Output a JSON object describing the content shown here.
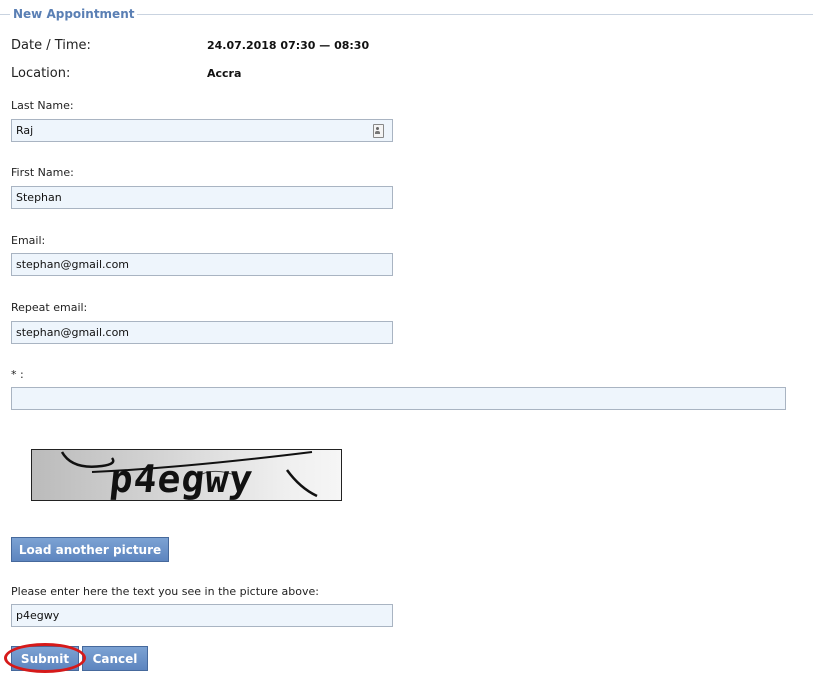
{
  "form": {
    "legend": "New Appointment",
    "date_time_label": "Date / Time:",
    "date_time_value": "24.07.2018 07:30 — 08:30",
    "location_label": "Location:",
    "location_value": "Accra",
    "last_name_label": "Last Name:",
    "last_name_value": "Raj",
    "first_name_label": "First Name:",
    "first_name_value": "Stephan",
    "email_label": "Email:",
    "email_value": "stephan@gmail.com",
    "repeat_email_label": "Repeat email:",
    "repeat_email_value": "stephan@gmail.com",
    "required_label": "* :",
    "required_value": ""
  },
  "captcha": {
    "image_text": "p4egwy",
    "reload_label": "Load another picture",
    "prompt_label": "Please enter here the text you see in the picture above:",
    "input_value": "p4egwy"
  },
  "actions": {
    "submit_label": "Submit",
    "cancel_label": "Cancel",
    "highlight_color": "#d61a1a"
  },
  "colors": {
    "legend": "#5a7fb4",
    "button": "#6a90c8",
    "input_bg": "#eef5fc"
  },
  "icons": {
    "contact_icon": "contact-card-icon"
  }
}
